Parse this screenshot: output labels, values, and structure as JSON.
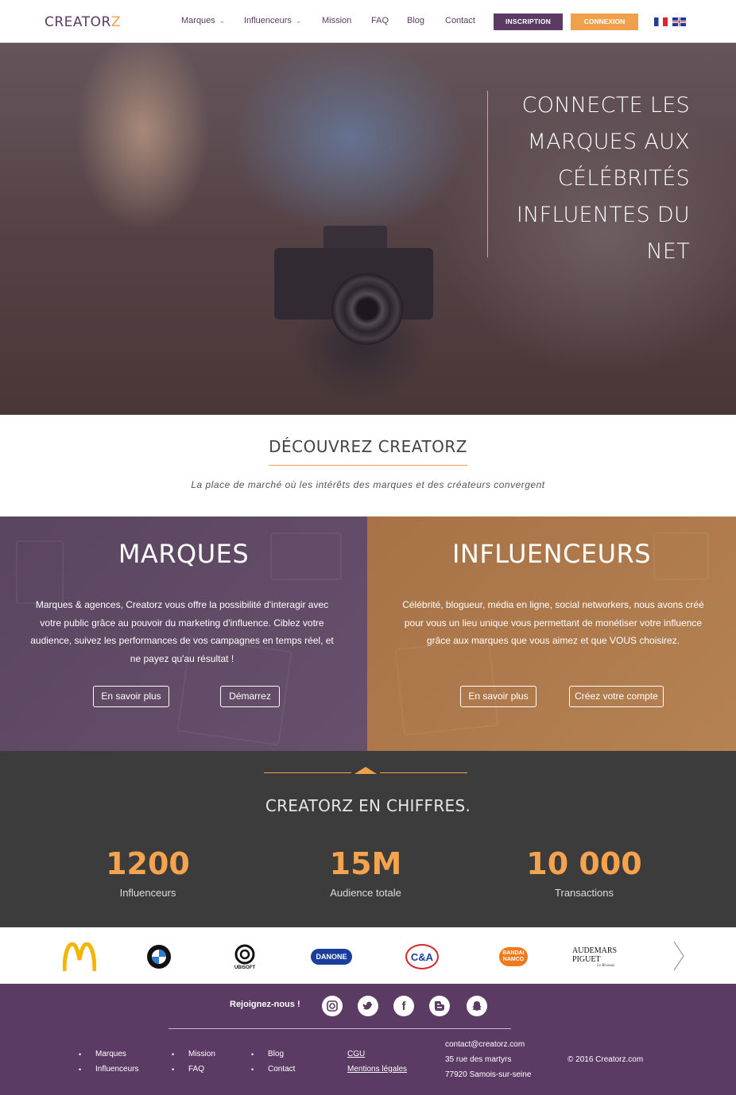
{
  "nav": {
    "logo_prefix": "CREATOR",
    "logo_suffix": "Z",
    "items": [
      {
        "label": "Marques",
        "dropdown": true
      },
      {
        "label": "Influenceurs",
        "dropdown": true
      },
      {
        "label": "Mission"
      },
      {
        "label": "FAQ"
      },
      {
        "label": "Blog"
      },
      {
        "label": "Contact"
      }
    ],
    "signup_label": "INSCRIPTION",
    "login_label": "CONNEXION"
  },
  "hero": {
    "line1": "CONNECTE LES",
    "line2": "MARQUES AUX",
    "line3": "CÉLÉBRITÉS",
    "line4": "INFLUENTES DU",
    "line5": "NET"
  },
  "discover": {
    "title": "DÉCOUVREZ CREATORZ",
    "subtitle": "La place de marché où les intérêts des marques et des créateurs convergent"
  },
  "panels": {
    "marques": {
      "title": "MARQUES",
      "text": "Marques & agences, Creatorz vous offre la possibilité d'interagir avec votre public grâce au pouvoir du marketing d'influence. Ciblez votre audience, suivez les performances de vos campagnes en temps réel, et ne payez qu'au résultat !",
      "btn1": "En savoir plus",
      "btn2": "Démarrez"
    },
    "influenceurs": {
      "title": "INFLUENCEURS",
      "text": "Célébrité, blogueur, média en ligne, social networkers, nous avons créé pour vous un lieu unique vous permettant de monétiser votre influence grâce aux marques que vous aimez et que VOUS choisirez.",
      "btn1": "En savoir plus",
      "btn2": "Créez votre compte"
    }
  },
  "stats": {
    "title": "CREATORZ EN CHIFFRES.",
    "items": [
      {
        "value": "1200",
        "label": "Influenceurs"
      },
      {
        "value": "15M",
        "label": "Audience totale"
      },
      {
        "value": "10 000",
        "label": "Transactions"
      }
    ]
  },
  "brands": {
    "ubisoft": "UBISOFT",
    "danone": "DANONE",
    "ca": "C&A",
    "bandai_1": "BANDAI",
    "bandai_2": "NAMCO",
    "ap_1": "AUDEMARS PIGUET",
    "ap_2": "Le Brassus"
  },
  "footer": {
    "join": "Rejoignez-nous !",
    "social_icons": [
      "instagram-icon",
      "twitter-icon",
      "facebook-icon",
      "blogger-icon",
      "snapchat-icon"
    ],
    "col1": [
      "Marques",
      "Influenceurs"
    ],
    "col2": [
      "Mission",
      "FAQ"
    ],
    "col3": [
      "Blog",
      "Contact"
    ],
    "col4": [
      "CGU",
      "Mentions légales"
    ],
    "email": "contact@creatorz.com",
    "address1": "35 rue des martyrs",
    "address2": "77920 Samois-sur-seine",
    "copyright": "© 2016 Creatorz.com"
  },
  "colors": {
    "purple": "#5b3a63",
    "orange": "#f0a04b",
    "dark": "#3c3c3c"
  }
}
